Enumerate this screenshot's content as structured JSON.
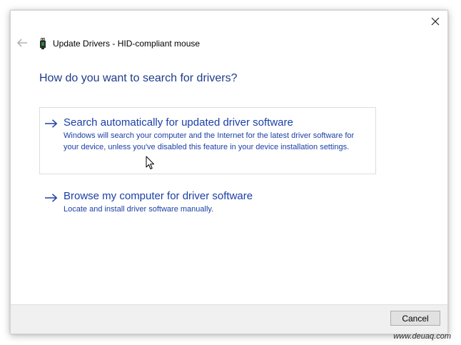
{
  "window": {
    "title": "Update Drivers - HID-compliant mouse"
  },
  "main": {
    "heading": "How do you want to search for drivers?",
    "options": [
      {
        "title": "Search automatically for updated driver software",
        "description": "Windows will search your computer and the Internet for the latest driver software for your device, unless you've disabled this feature in your device installation settings."
      },
      {
        "title": "Browse my computer for driver software",
        "description": "Locate and install driver software manually."
      }
    ]
  },
  "footer": {
    "cancel_label": "Cancel"
  },
  "watermark": "www.deuaq.com",
  "colors": {
    "link_blue": "#1a3fa6",
    "heading_blue": "#1f3c8c",
    "footer_bg": "#f0f0f0"
  },
  "icons": {
    "close": "close-icon",
    "back": "back-arrow-icon",
    "device": "usb-device-icon",
    "option_arrow": "arrow-right-icon"
  }
}
